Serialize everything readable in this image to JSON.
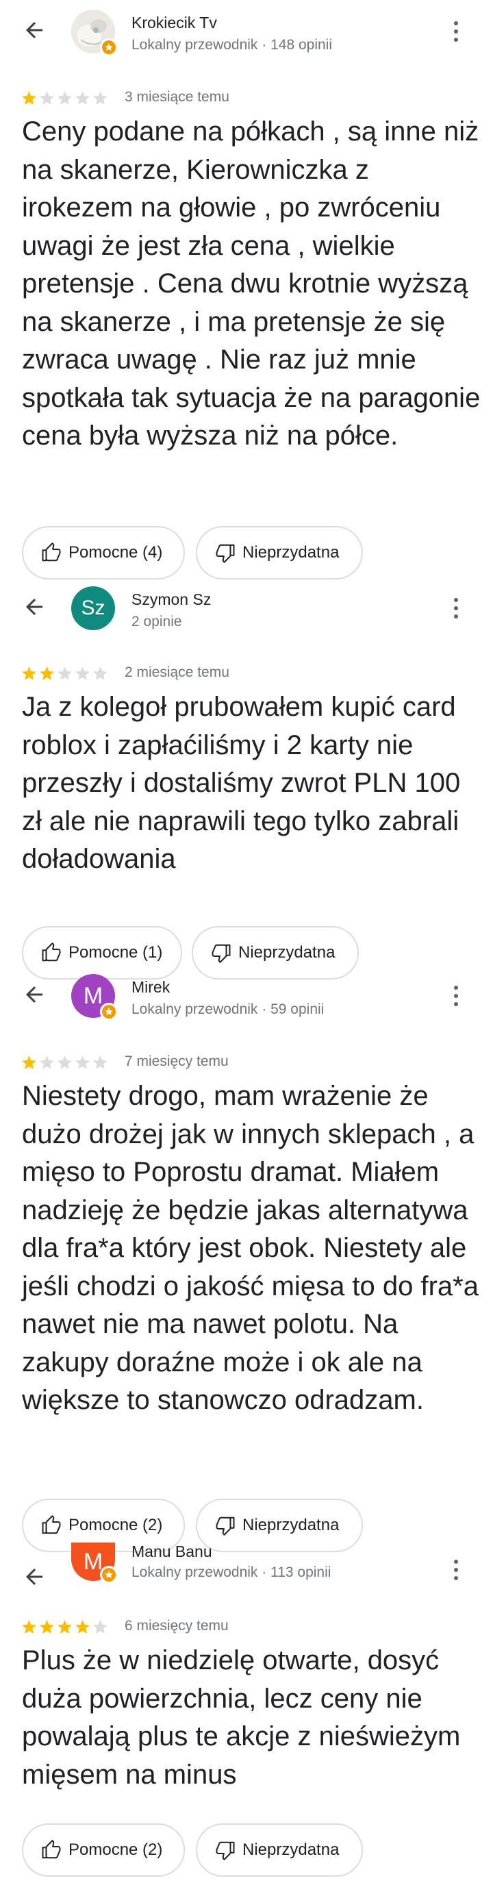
{
  "colors": {
    "star_filled": "#fbbc04",
    "star_empty": "#dadce0",
    "local_guide_badge": "#f29900"
  },
  "icons": [
    "back-arrow-icon",
    "more-vert-icon",
    "star-icon",
    "thumb-up-icon",
    "thumb-down-icon",
    "local-guide-badge-icon"
  ],
  "reviews": [
    {
      "author": "Krokiecik Tv",
      "author_meta": "Lokalny przewodnik · 148 opinii",
      "avatar_initials": "",
      "avatar_color": "#e8e4dc",
      "local_guide": true,
      "rating": 1,
      "date": "3 miesiące temu",
      "text": "Ceny podane na półkach , są inne niż na skanerze, Kierowniczka z irokezem na głowie , po zwróceniu uwagi że jest zła cena , wielkie pretensje  . Cena dwu krotnie wyższą na skanerze  , i ma pretensje że się zwraca uwagę . Nie raz już mnie spotkała tak sytuacja że na paragonie cena była wyższa niż na półce.",
      "helpful_label": "Pomocne (4)",
      "unhelpful_label": "Nieprzydatna"
    },
    {
      "author": "Szymon Sz",
      "author_meta": "2 opinie",
      "avatar_initials": "Sz",
      "avatar_color": "#0f8a7e",
      "local_guide": false,
      "rating": 2,
      "date": "2 miesiące temu",
      "text": "Ja z kolegoł prubowałem kupić card roblox i zapłaćiliśmy i 2 karty nie przeszły i dostaliśmy zwrot PLN 100 zł ale nie naprawili tego tylko zabrali doładowania",
      "helpful_label": "Pomocne (1)",
      "unhelpful_label": "Nieprzydatna"
    },
    {
      "author": "Mirek",
      "author_meta": "Lokalny przewodnik · 59 opinii",
      "avatar_initials": "M",
      "avatar_color": "#a142c2",
      "local_guide": true,
      "rating": 1,
      "date": "7 miesięcy temu",
      "text": "Niestety drogo, mam wrażenie że dużo drożej jak w innych sklepach , a mięso to Poprostu dramat. Miałem nadzieję że będzie jakas alternatywa dla fra*a który jest obok. Niestety ale jeśli chodzi o jakość mięsa to do fra*a nawet nie ma nawet polotu. Na zakupy doraźne może i ok ale na większe to stanowczo odradzam.",
      "helpful_label": "Pomocne (2)",
      "unhelpful_label": "Nieprzydatna"
    },
    {
      "author": "Manu Banu",
      "author_meta": "Lokalny przewodnik · 113 opinii",
      "avatar_initials": "M",
      "avatar_color": "#f4511e",
      "local_guide": true,
      "rating": 4,
      "date": "6 miesięcy temu",
      "text": "Plus że w niedzielę otwarte, dosyć duża powierzchnia, lecz ceny nie powalają plus te akcje z nieświeżym mięsem na minus",
      "helpful_label": "Pomocne (2)",
      "unhelpful_label": "Nieprzydatna"
    }
  ]
}
